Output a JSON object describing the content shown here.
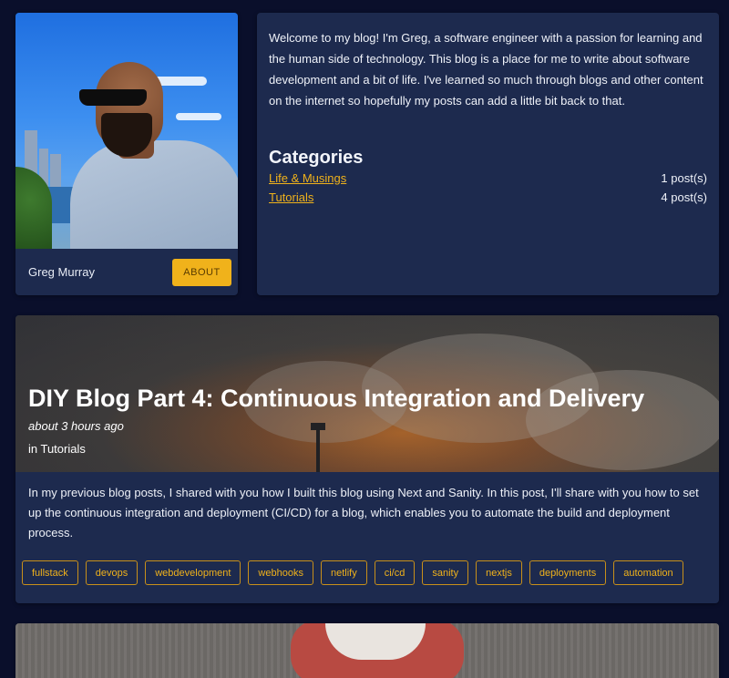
{
  "profile": {
    "name": "Greg Murray",
    "about_label": "ABOUT",
    "photo_icon": "profile-photo"
  },
  "intro": {
    "text": "Welcome to my blog! I'm Greg, a software engineer with a passion for learning and the human side of technology. This blog is a place for me to write about software development and a bit of life. I've learned so much through blogs and other content on the internet so hopefully my posts can add a little bit back to that."
  },
  "categories": {
    "title": "Categories",
    "items": [
      {
        "label": "Life & Musings",
        "count": "1 post(s)"
      },
      {
        "label": "Tutorials",
        "count": "4 post(s)"
      }
    ]
  },
  "post": {
    "title": "DIY Blog Part 4: Continuous Integration and Delivery",
    "date": "about 3 hours ago",
    "category": "in Tutorials",
    "excerpt": "In my previous blog posts, I shared with you how I built this blog using Next and Sanity. In this post, I'll share with you how to set up the continuous integration and deployment (CI/CD) for a blog, which enables you to automate the build and deployment process.",
    "tags": [
      "fullstack",
      "devops",
      "webdevelopment",
      "webhooks",
      "netlify",
      "ci/cd",
      "sanity",
      "nextjs",
      "deployments",
      "automation"
    ]
  },
  "colors": {
    "background": "#0a0f2b",
    "card": "#1d2a4e",
    "accent": "#f0b21b"
  }
}
